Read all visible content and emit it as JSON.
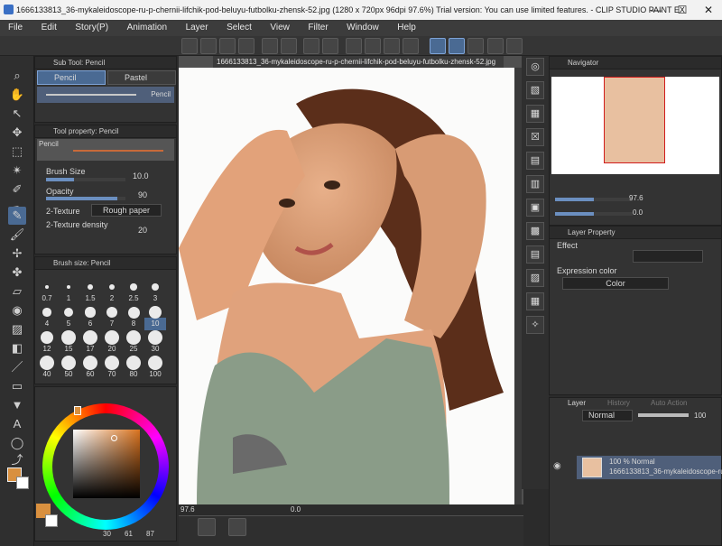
{
  "window": {
    "title": "1666133813_36-mykaleidoscope-ru-p-chernii-lifchik-pod-beluyu-futbolku-zhensk-52.jpg (1280 x 720px 96dpi 97.6%)  Trial version: You can use limited features. - CLIP STUDIO PAINT EX",
    "minimize": "—",
    "maximize": "☐",
    "close": "✕"
  },
  "menu": [
    "File",
    "Edit",
    "Story(P)",
    "Animation",
    "Layer",
    "Select",
    "View",
    "Filter",
    "Window",
    "Help"
  ],
  "subtool": {
    "header": "Sub Tool: Pencil",
    "tabs": [
      "Pencil",
      "Pastel"
    ],
    "selected_brush": "Pencil"
  },
  "tool_property": {
    "header": "Tool property: Pencil",
    "preview_label": "Pencil",
    "brush_size_label": "Brush Size",
    "brush_size_value": "10.0",
    "opacity_label": "Opacity",
    "opacity_value": "90",
    "texture_label": "2-Texture",
    "texture_value": "Rough paper",
    "texture_density_label": "2-Texture density",
    "texture_density_value": "20"
  },
  "brush_size_panel": {
    "header": "Brush size: Pencil",
    "sizes": [
      "0.7",
      "1",
      "1.5",
      "2",
      "2.5",
      "3",
      "4",
      "5",
      "6",
      "7",
      "8",
      "10",
      "12",
      "15",
      "17",
      "20",
      "25",
      "30",
      "40",
      "50",
      "60",
      "70",
      "80",
      "100"
    ]
  },
  "color": {
    "main": "#d9903f",
    "sub": "#ffffff",
    "hue_readout": [
      "30",
      "61",
      "87"
    ],
    "hue_colors": {
      "accent": "#4a6a93"
    }
  },
  "canvas": {
    "tab_label": "1666133813_36-mykaleidoscope-ru-p-chernii-lifchik-pod-beluyu-futbolku-zhensk-52.jpg",
    "zoom": "97.6",
    "rotation": "0.0"
  },
  "navigator": {
    "header": "Navigator",
    "zoom": "97.6",
    "rotation": "0.0"
  },
  "layer_property": {
    "header": "Layer Property",
    "effect_label": "Effect",
    "expression_color_label": "Expression color",
    "expression_color_value": "Color"
  },
  "layer_panel": {
    "tabs": [
      "Layer",
      "History",
      "Auto Action"
    ],
    "blend_mode": "Normal",
    "opacity": "100",
    "layers": [
      {
        "line1": "100 % Normal",
        "line2": "1666133813_36-mykaleidoscope-ru-p"
      }
    ]
  }
}
